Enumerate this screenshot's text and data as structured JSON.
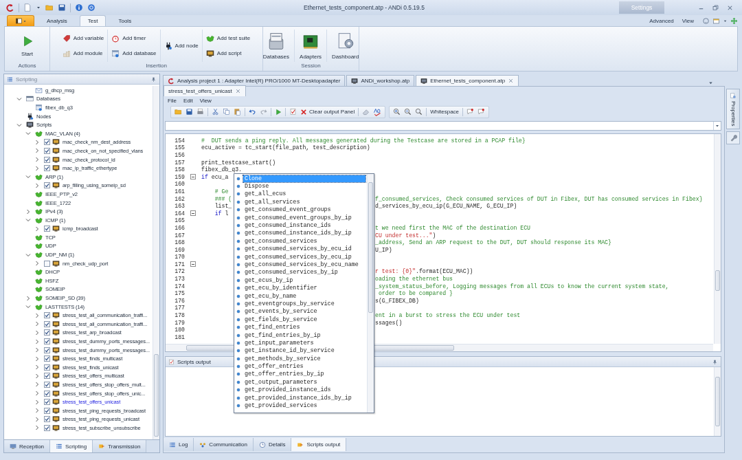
{
  "title_bar": {
    "title": "Ethernet_tests_component.atp - ANDi 0.5.19.5",
    "settings": "Settings"
  },
  "ribbon": {
    "tabs": [
      {
        "label": "Analysis",
        "selected": false
      },
      {
        "label": "Test",
        "selected": true
      },
      {
        "label": "Tools",
        "selected": false
      }
    ],
    "links": [
      "Advanced",
      "View"
    ],
    "groups": [
      {
        "label": "Actions",
        "columns": [
          [
            {
              "label": "Start",
              "kind": "large"
            }
          ]
        ]
      },
      {
        "label": "Insertion",
        "columns": [
          [
            {
              "label": "Add variable",
              "kind": "small"
            },
            {
              "label": "Add module",
              "kind": "small"
            }
          ],
          [
            {
              "label": "Add timer",
              "kind": "small"
            },
            {
              "label": "Add database",
              "kind": "small"
            }
          ],
          [
            {
              "label": "Add node",
              "kind": "small"
            }
          ],
          [
            {
              "label": "Add test suite",
              "kind": "small"
            },
            {
              "label": "Add script",
              "kind": "small"
            }
          ]
        ]
      },
      {
        "label": "Session",
        "columns": [
          [
            {
              "label": "Databases",
              "kind": "large"
            }
          ],
          [
            {
              "label": "Adapters",
              "kind": "large"
            }
          ],
          [
            {
              "label": "Dashboard",
              "kind": "large"
            }
          ]
        ]
      }
    ]
  },
  "scripting_panel": {
    "title": "Scripting",
    "tree": {
      "continued": [
        {
          "label": "g_dhcp_msg",
          "kind": "message",
          "selected": false
        }
      ],
      "items": [
        {
          "label": "Databases",
          "kind": "databases",
          "expanded": true,
          "selected": false,
          "children": [
            {
              "label": "fibex_db_q3",
              "kind": "database",
              "selected": false
            }
          ]
        },
        {
          "label": "Nodes",
          "kind": "nodes",
          "selected": false
        },
        {
          "label": "Scripts",
          "kind": "scripts",
          "expanded": true,
          "selected": false,
          "children": [
            {
              "label": "MAC_VLAN (4)",
              "kind": "suite",
              "expanded": true,
              "selected": false,
              "children": [
                {
                  "label": "mac_check_nm_dest_address",
                  "kind": "script",
                  "expanded": false,
                  "checked": true,
                  "selected": false
                },
                {
                  "label": "mac_check_on_not_specified_vlans",
                  "kind": "script",
                  "expanded": false,
                  "checked": true,
                  "selected": false
                },
                {
                  "label": "mac_check_protocol_id",
                  "kind": "script",
                  "expanded": false,
                  "checked": true,
                  "selected": false
                },
                {
                  "label": "mac_ip_traffic_ethertype",
                  "kind": "script",
                  "expanded": false,
                  "checked": true,
                  "selected": false
                }
              ]
            },
            {
              "label": "ARP (1)",
              "kind": "suite",
              "expanded": true,
              "selected": false,
              "children": [
                {
                  "label": "arp_filling_using_someip_sd",
                  "kind": "script",
                  "expanded": false,
                  "checked": true,
                  "selected": false
                }
              ]
            },
            {
              "label": "IEEE_PTP_v2",
              "kind": "suite",
              "selected": false
            },
            {
              "label": "IEEE_1722",
              "kind": "suite",
              "selected": false
            },
            {
              "label": "IPv4 (3)",
              "kind": "suite",
              "expanded": false,
              "selected": false
            },
            {
              "label": "ICMP (1)",
              "kind": "suite",
              "expanded": true,
              "selected": false,
              "children": [
                {
                  "label": "icmp_broadcast",
                  "kind": "script",
                  "expanded": false,
                  "checked": true,
                  "selected": false
                }
              ]
            },
            {
              "label": "TCP",
              "kind": "suite",
              "selected": false
            },
            {
              "label": "UDP",
              "kind": "suite",
              "selected": false
            },
            {
              "label": "UDP_NM (1)",
              "kind": "suite",
              "expanded": true,
              "selected": false,
              "children": [
                {
                  "label": "nm_check_udp_port",
                  "kind": "script",
                  "expanded": false,
                  "checked": false,
                  "selected": false
                }
              ]
            },
            {
              "label": "DHCP",
              "kind": "suite",
              "selected": false
            },
            {
              "label": "HSFZ",
              "kind": "suite",
              "selected": false
            },
            {
              "label": "SOMEIP",
              "kind": "suite",
              "selected": false
            },
            {
              "label": "SOMEIP_SD (39)",
              "kind": "suite",
              "expanded": false,
              "selected": false
            },
            {
              "label": "LASTTESTS (14)",
              "kind": "suite",
              "expanded": true,
              "selected": false,
              "children": [
                {
                  "label": "stress_test_all_communication_traffi...",
                  "kind": "script",
                  "expanded": false,
                  "checked": true,
                  "selected": false
                },
                {
                  "label": "stress_test_all_communication_traffi...",
                  "kind": "script",
                  "expanded": false,
                  "checked": true,
                  "selected": false
                },
                {
                  "label": "stress_test_arp_broadcast",
                  "kind": "script",
                  "expanded": false,
                  "checked": true,
                  "selected": false
                },
                {
                  "label": "stress_test_dummy_ports_messages...",
                  "kind": "script",
                  "expanded": false,
                  "checked": true,
                  "selected": false
                },
                {
                  "label": "stress_test_dummy_ports_messages...",
                  "kind": "script",
                  "expanded": false,
                  "checked": true,
                  "selected": false
                },
                {
                  "label": "stress_test_finds_multicast",
                  "kind": "script",
                  "expanded": false,
                  "checked": true,
                  "selected": false
                },
                {
                  "label": "stress_test_finds_unicast",
                  "kind": "script",
                  "expanded": false,
                  "checked": true,
                  "selected": false
                },
                {
                  "label": "stress_test_offers_multicast",
                  "kind": "script",
                  "expanded": false,
                  "checked": true,
                  "selected": false
                },
                {
                  "label": "stress_test_offers_stop_offers_mult...",
                  "kind": "script",
                  "expanded": false,
                  "checked": true,
                  "selected": false
                },
                {
                  "label": "stress_test_offers_stop_offers_unic...",
                  "kind": "script",
                  "expanded": false,
                  "checked": true,
                  "selected": false
                },
                {
                  "label": "stress_test_offers_unicast",
                  "kind": "script",
                  "expanded": false,
                  "checked": true,
                  "selected": true
                },
                {
                  "label": "stress_test_ping_requests_broadcast",
                  "kind": "script",
                  "expanded": false,
                  "checked": true,
                  "selected": false
                },
                {
                  "label": "stress_test_ping_requests_unicast",
                  "kind": "script",
                  "expanded": false,
                  "checked": true,
                  "selected": false
                },
                {
                  "label": "stress_test_subscribe_unsubscribe",
                  "kind": "script",
                  "expanded": false,
                  "checked": true,
                  "selected": false
                }
              ]
            }
          ]
        }
      ]
    },
    "tabs": [
      {
        "label": "Reception",
        "selected": false
      },
      {
        "label": "Scripting",
        "selected": true
      },
      {
        "label": "Transmission",
        "selected": false
      }
    ]
  },
  "document_tabs": [
    {
      "label": "Analysis project 1 : Adapter Intel(R) PRO/1000 MT-Desktopadapter",
      "selected": false
    },
    {
      "label": "ANDi_workshop.atp",
      "selected": false
    },
    {
      "label": "Ethernet_tests_component.atp",
      "selected": true
    }
  ],
  "editor": {
    "tabs": [
      {
        "label": "stress_test_offers_unicast",
        "selected": true
      }
    ],
    "menu": [
      "File",
      "Edit",
      "View"
    ],
    "toolbar": {
      "clear_button": "Clear output Panel",
      "whitespace_button": "Whitespace"
    },
    "lines": [
      {
        "number": "154",
        "fold": false,
        "left": [
          {
            "kind": "comment",
            "text": "#  DUT sends a ping reply. All messages generated during the Testcase are stored in a PCAP file}"
          }
        ]
      },
      {
        "number": "155",
        "fold": false,
        "left": [
          {
            "kind": "code",
            "text": "ecu_active = tc_start(file_path, test_description)"
          }
        ]
      },
      {
        "number": "156",
        "fold": false
      },
      {
        "number": "157",
        "fold": false,
        "left": [
          {
            "kind": "code",
            "text": "print_testcase_start()"
          }
        ]
      },
      {
        "number": "158",
        "fold": false,
        "left": [
          {
            "kind": "code",
            "text": "fibex_db_q3."
          }
        ]
      },
      {
        "number": "159",
        "fold": true,
        "left": [
          {
            "kind": "keyword",
            "text": "if"
          },
          {
            "kind": "code",
            "text": " ecu_a"
          }
        ]
      },
      {
        "number": "160",
        "fold": false
      },
      {
        "number": "161",
        "fold": false,
        "left": [
          {
            "kind": "comment",
            "text": "    # Ge"
          }
        ]
      },
      {
        "number": "162",
        "fold": false,
        "left": [
          {
            "kind": "comment",
            "text": "    ### ("
          }
        ],
        "right": [
          {
            "kind": "comment",
            "text": "f_consumed_services, Check consumed services of DUT in Fibex, DUT has consumed services in Fibex}"
          }
        ]
      },
      {
        "number": "163",
        "fold": false,
        "left": [
          {
            "kind": "code",
            "text": "    list_"
          }
        ],
        "right": [
          {
            "kind": "code",
            "text": "d_services_by_ecu_ip(G_ECU_NAME, G_ECU_IP)"
          }
        ]
      },
      {
        "number": "164",
        "fold": true,
        "left": [
          {
            "kind": "keyword",
            "text": "    if"
          },
          {
            "kind": "code",
            "text": " l"
          }
        ]
      },
      {
        "number": "165",
        "fold": false
      },
      {
        "number": "166",
        "fold": false,
        "right": [
          {
            "kind": "comment",
            "text": "t we need first the MAC of the destination ECU"
          }
        ]
      },
      {
        "number": "167",
        "fold": false,
        "right": [
          {
            "kind": "string",
            "text": "CU under test...\""
          },
          {
            "kind": "code",
            "text": ")"
          }
        ]
      },
      {
        "number": "168",
        "fold": false,
        "right": [
          {
            "kind": "comment",
            "text": "_address, Send an ARP request to the DUT, DUT should response its MAC}"
          }
        ]
      },
      {
        "number": "169",
        "fold": false,
        "right": [
          {
            "kind": "code",
            "text": "U_IP)"
          }
        ]
      },
      {
        "number": "170",
        "fold": false
      },
      {
        "number": "171",
        "fold": true
      },
      {
        "number": "172",
        "fold": false,
        "right": [
          {
            "kind": "string",
            "text": "r test: {0}\""
          },
          {
            "kind": "code",
            "text": ".format(ECU_MAC))"
          }
        ]
      },
      {
        "number": "173",
        "fold": false,
        "right": [
          {
            "kind": "comment",
            "text": "oading the ethernet bus"
          }
        ]
      },
      {
        "number": "174",
        "fold": false,
        "right": [
          {
            "kind": "comment",
            "text": "_system_status_before, Logging messages from all ECUs to know the current system state,"
          }
        ]
      },
      {
        "number": "175",
        "fold": false,
        "right": [
          {
            "kind": "comment",
            "text": " order to be compared }"
          }
        ]
      },
      {
        "number": "176",
        "fold": false,
        "right": [
          {
            "kind": "code",
            "text": "s(G_FIBEX_DB)"
          }
        ]
      },
      {
        "number": "177",
        "fold": false
      },
      {
        "number": "178",
        "fold": false,
        "right": [
          {
            "kind": "comment",
            "text": "ent in a burst to stress the ECU under test"
          }
        ]
      },
      {
        "number": "179",
        "fold": false,
        "right": [
          {
            "kind": "code",
            "text": "ssages()"
          }
        ]
      },
      {
        "number": "180",
        "fold": false
      },
      {
        "number": "181",
        "fold": false
      }
    ]
  },
  "completion_popup": {
    "items": [
      {
        "label": "Clone",
        "selected": true
      },
      {
        "label": "Dispose",
        "selected": false
      },
      {
        "label": "get_all_ecus",
        "selected": false
      },
      {
        "label": "get_all_services",
        "selected": false
      },
      {
        "label": "get_consumed_event_groups",
        "selected": false
      },
      {
        "label": "get_consumed_event_groups_by_ip",
        "selected": false
      },
      {
        "label": "get_consumed_instance_ids",
        "selected": false
      },
      {
        "label": "get_consumed_instance_ids_by_ip",
        "selected": false
      },
      {
        "label": "get_consumed_services",
        "selected": false
      },
      {
        "label": "get_consumed_services_by_ecu_id",
        "selected": false
      },
      {
        "label": "get_consumed_services_by_ecu_ip",
        "selected": false
      },
      {
        "label": "get_consumed_services_by_ecu_name",
        "selected": false
      },
      {
        "label": "get_consumed_services_by_ip",
        "selected": false
      },
      {
        "label": "get_ecus_by_ip",
        "selected": false
      },
      {
        "label": "get_ecu_by_identifier",
        "selected": false
      },
      {
        "label": "get_ecu_by_name",
        "selected": false
      },
      {
        "label": "get_eventgroups_by_service",
        "selected": false
      },
      {
        "label": "get_events_by_service",
        "selected": false
      },
      {
        "label": "get_fields_by_service",
        "selected": false
      },
      {
        "label": "get_find_entries",
        "selected": false
      },
      {
        "label": "get_find_entries_by_ip",
        "selected": false
      },
      {
        "label": "get_input_parameters",
        "selected": false
      },
      {
        "label": "get_instance_id_by_service",
        "selected": false
      },
      {
        "label": "get_methods_by_service",
        "selected": false
      },
      {
        "label": "get_offer_entries",
        "selected": false
      },
      {
        "label": "get_offer_entries_by_ip",
        "selected": false
      },
      {
        "label": "get_output_parameters",
        "selected": false
      },
      {
        "label": "get_provided_instance_ids",
        "selected": false
      },
      {
        "label": "get_provided_instance_ids_by_ip",
        "selected": false
      },
      {
        "label": "get_provided_services",
        "selected": false
      }
    ]
  },
  "output_panel": {
    "title": "Scripts output"
  },
  "bottom_tabs": [
    {
      "label": "Log",
      "selected": false
    },
    {
      "label": "Communication",
      "selected": false
    },
    {
      "label": "Details",
      "selected": false
    },
    {
      "label": "Scripts output",
      "selected": true
    }
  ],
  "side_panel": {
    "tabs": [
      "Properties"
    ]
  }
}
